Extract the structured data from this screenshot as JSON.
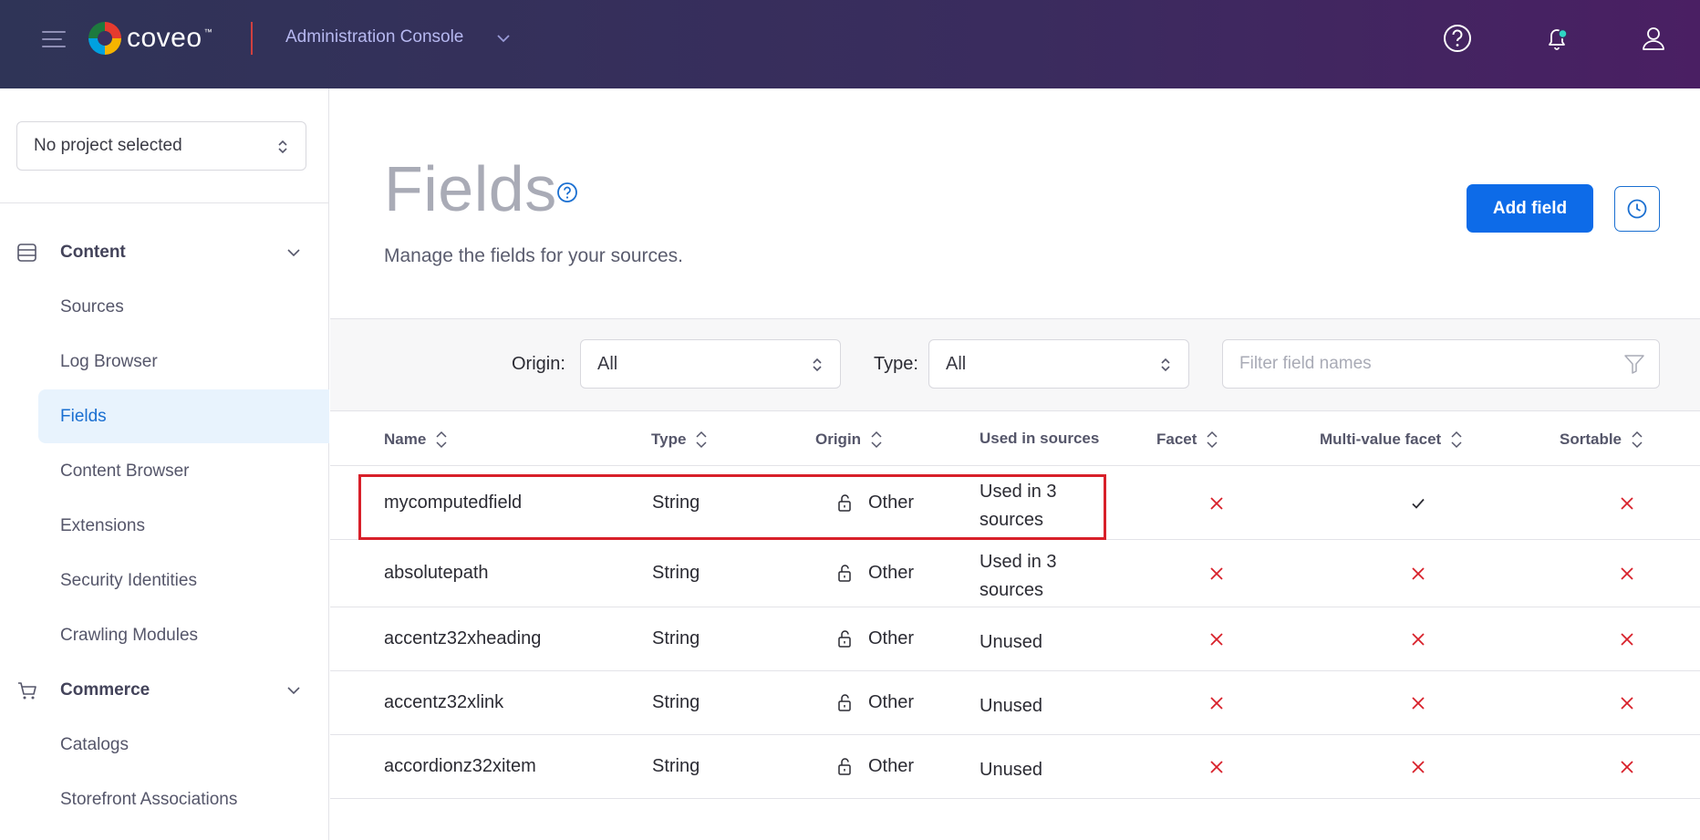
{
  "header": {
    "brand": "coveo",
    "trademark": "™",
    "console_title": "Administration Console",
    "colors": {
      "accent": "#0d6be8",
      "notification_dot": "#2fd6c4",
      "error_mark": "#d8202a",
      "check_mark": "#2b2b33"
    }
  },
  "sidebar": {
    "project_select": "No project selected",
    "sections": [
      {
        "label": "Content",
        "icon": "database-icon",
        "items": [
          {
            "label": "Sources",
            "active": false
          },
          {
            "label": "Log Browser",
            "active": false
          },
          {
            "label": "Fields",
            "active": true
          },
          {
            "label": "Content Browser",
            "active": false
          },
          {
            "label": "Extensions",
            "active": false
          },
          {
            "label": "Security Identities",
            "active": false
          },
          {
            "label": "Crawling Modules",
            "active": false
          }
        ]
      },
      {
        "label": "Commerce",
        "icon": "cart-icon",
        "items": [
          {
            "label": "Catalogs",
            "active": false
          },
          {
            "label": "Storefront Associations",
            "active": false
          }
        ]
      }
    ]
  },
  "main": {
    "title": "Fields",
    "description": "Manage the fields for your sources.",
    "add_button": "Add field",
    "filters": {
      "origin_label": "Origin:",
      "origin_value": "All",
      "type_label": "Type:",
      "type_value": "All",
      "search_placeholder": "Filter field names"
    },
    "columns": [
      "Name",
      "Type",
      "Origin",
      "Used in sources",
      "Facet",
      "Multi-value facet",
      "Sortable"
    ],
    "rows": [
      {
        "name": "mycomputedfield",
        "type": "String",
        "origin": "Other",
        "used_line1": "Used in 3",
        "used_line2": "sources",
        "facet": false,
        "multi_value_facet": true,
        "sortable": false
      },
      {
        "name": "absolutepath",
        "type": "String",
        "origin": "Other",
        "used_line1": "Used in 3",
        "used_line2": "sources",
        "facet": false,
        "multi_value_facet": false,
        "sortable": false
      },
      {
        "name": "accentz32xheading",
        "type": "String",
        "origin": "Other",
        "used_line1": "Unused",
        "used_line2": "",
        "facet": false,
        "multi_value_facet": false,
        "sortable": false
      },
      {
        "name": "accentz32xlink",
        "type": "String",
        "origin": "Other",
        "used_line1": "Unused",
        "used_line2": "",
        "facet": false,
        "multi_value_facet": false,
        "sortable": false
      },
      {
        "name": "accordionz32xitem",
        "type": "String",
        "origin": "Other",
        "used_line1": "Unused",
        "used_line2": "",
        "facet": false,
        "multi_value_facet": false,
        "sortable": false
      }
    ]
  }
}
